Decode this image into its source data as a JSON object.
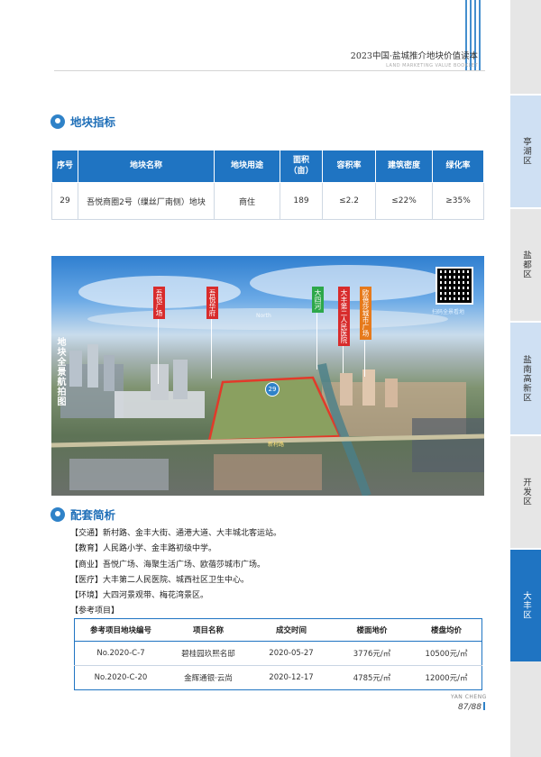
{
  "header": {
    "title": "2023中国·盐城推介地块价值读本",
    "subtitle": "LAND MARKETING VALUE BOOKLET"
  },
  "section_land": {
    "title": "地块指标",
    "columns": [
      "序号",
      "地块名称",
      "地块用途",
      "面积\n（亩）",
      "容积率",
      "建筑密度",
      "绿化率"
    ],
    "row": [
      "29",
      "吾悦商圈2号（缫丝厂南侧）地块",
      "商住",
      "189",
      "≤2.2",
      "≤22%",
      "≥35%"
    ]
  },
  "photo": {
    "side_label": "地块全景航拍图",
    "tags": [
      {
        "text": "吾悦广场",
        "color": "#d82c2c"
      },
      {
        "text": "吾悦华府",
        "color": "#d82c2c"
      },
      {
        "text": "大四河",
        "color": "#2da84a"
      },
      {
        "text": "大丰第二人民医院",
        "color": "#d82c2c"
      },
      {
        "text": "欧蓓莎城市广场",
        "color": "#e67a1c"
      }
    ],
    "lot_number": "29",
    "road_label": "新村路",
    "north_label": "North",
    "qr_caption": "扫码全景看地"
  },
  "section_facilities": {
    "title": "配套简析",
    "lines": [
      "【交通】新村路、金丰大街、通港大道、大丰城北客运站。",
      "【教育】人民路小学、金丰路初级中学。",
      "【商业】吾悦广场、海聚生活广场、欧蓓莎城市广场。",
      "【医疗】大丰第二人民医院、城西社区卫生中心。",
      "【环境】大四河景观带、梅花湾景区。",
      "【参考项目】"
    ]
  },
  "reference": {
    "columns": [
      "参考项目地块编号",
      "项目名称",
      "成交时间",
      "楼面地价",
      "楼盘均价"
    ],
    "rows": [
      [
        "No.2020-C-7",
        "碧桂园玖熙名邸",
        "2020-05-27",
        "3776元/㎡",
        "10500元/㎡"
      ],
      [
        "No.2020-C-20",
        "金辉通银·云尚",
        "2020-12-17",
        "4785元/㎡",
        "12000元/㎡"
      ]
    ]
  },
  "footer": {
    "brand": "YAN CHENG",
    "page": "87/88"
  },
  "sidenav": {
    "items": [
      "亭湖区",
      "盐都区",
      "盐南高新区",
      "开发区",
      "大丰区"
    ],
    "active": "大丰区"
  },
  "colors": {
    "accent": "#1f74c2",
    "tab_active": "#1f74c2",
    "tab_inactive": "#e6e6e6",
    "tab_blue": "#cfe0f3"
  }
}
